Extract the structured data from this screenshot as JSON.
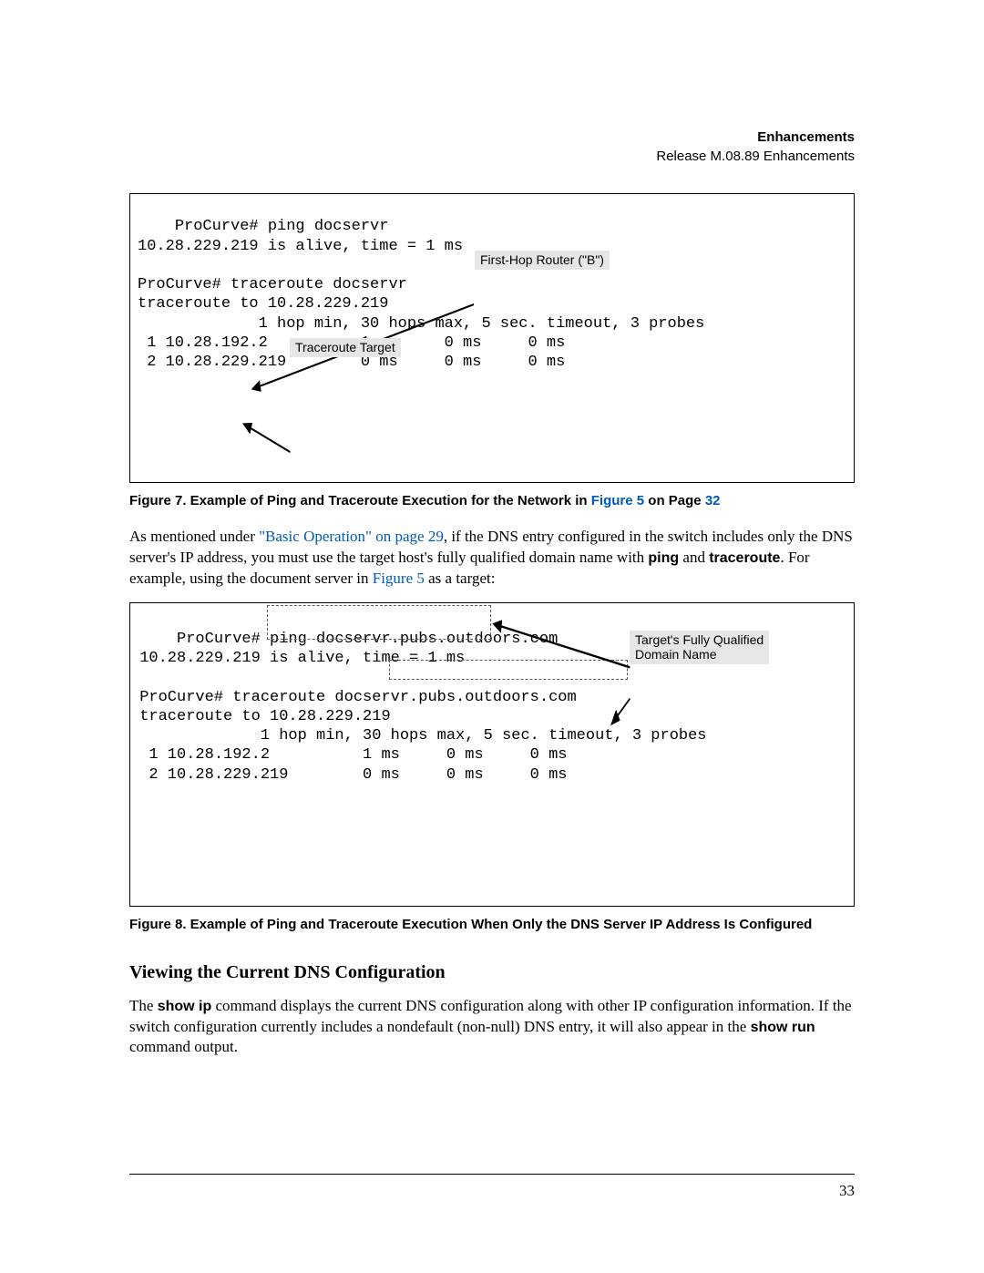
{
  "header": {
    "title_bold": "Enhancements",
    "subtitle": "Release M.08.89 Enhancements"
  },
  "figure7": {
    "code": "ProCurve# ping docservr\n10.28.229.219 is alive, time = 1 ms\n\nProCurve# traceroute docservr\ntraceroute to 10.28.229.219\n             1 hop min, 30 hops max, 5 sec. timeout, 3 probes\n 1 10.28.192.2          1 ms     0 ms     0 ms\n 2 10.28.229.219        0 ms     0 ms     0 ms",
    "callout_router": "First-Hop Router (\"B\")",
    "callout_target": "Traceroute Target",
    "caption_prefix": "Figure 7.  Example of Ping and Traceroute Execution for the Network in ",
    "caption_link1": "Figure 5",
    "caption_mid": " on Page ",
    "caption_link2": "32"
  },
  "para1": {
    "t1": "As mentioned under ",
    "link": "\"Basic Operation\" on page 29",
    "t2": ", if the DNS entry configured in the switch includes only the DNS server's IP address, you must use the target host's fully qualified domain name with ",
    "b1": "ping",
    "t3": " and ",
    "b2": "traceroute",
    "t4": ". For example, using the document server in ",
    "link2": "Figure 5",
    "t5": " as a target:"
  },
  "figure8": {
    "code": " ProCurve# ping docservr.pubs.outdoors.com\n 10.28.229.219 is alive, time = 1 ms\n\n ProCurve# traceroute docservr.pubs.outdoors.com\n traceroute to 10.28.229.219\n              1 hop min, 30 hops max, 5 sec. timeout, 3 probes\n  1 10.28.192.2          1 ms     0 ms     0 ms\n  2 10.28.229.219        0 ms     0 ms     0 ms",
    "callout_fqdn": "Target's Fully Qualified\nDomain Name",
    "caption": "Figure 8.  Example of Ping and Traceroute Execution When Only the DNS Server IP Address Is Configured"
  },
  "subhead": "Viewing the Current DNS Configuration",
  "para2": {
    "t1": "The ",
    "b1": "show ip",
    "t2": " command displays the current DNS configuration along with other IP configuration information. If the switch configuration currently includes a nondefault (non-null) DNS entry, it will also appear in the ",
    "b2": "show run",
    "t3": " command output."
  },
  "pageno": "33"
}
